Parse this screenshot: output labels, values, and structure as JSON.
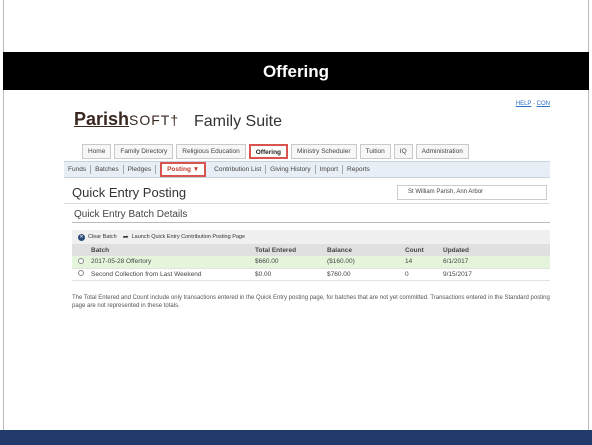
{
  "slide": {
    "title": "Offering",
    "accent_color": "#1f3a6b"
  },
  "app": {
    "top_links": [
      "HELP",
      "-",
      "CON"
    ],
    "logo_part1": "Parish",
    "logo_part2": "SOFT",
    "product_name": "Family Suite"
  },
  "main_nav": [
    {
      "label": "Home"
    },
    {
      "label": "Family Directory"
    },
    {
      "label": "Religious Education"
    },
    {
      "label": "Offering"
    },
    {
      "label": "Ministry Scheduler"
    },
    {
      "label": "Tuition"
    },
    {
      "label": "IQ"
    },
    {
      "label": "Administration"
    }
  ],
  "sub_nav": [
    {
      "label": "Funds"
    },
    {
      "label": "Batches"
    },
    {
      "label": "Pledges"
    },
    {
      "label": "Posting ▼"
    },
    {
      "label": "Contribution List"
    },
    {
      "label": "Giving History"
    },
    {
      "label": "Import"
    },
    {
      "label": "Reports"
    }
  ],
  "page": {
    "title": "Quick Entry Posting",
    "parish": "St William Parish, Ann Arbor",
    "section_title": "Quick Entry Batch Details",
    "toolbar": {
      "clear": "Clear Batch",
      "launch": "Launch Quick Entry Contribution Posting Page"
    },
    "table": {
      "headers": [
        "",
        "Batch",
        "Total Entered",
        "Balance",
        "Count",
        "Updated"
      ],
      "rows": [
        {
          "batch": "2017-05-28 Offertory",
          "total": "$660.00",
          "balance": "($160.00)",
          "count": "14",
          "updated": "6/1/2017"
        },
        {
          "batch": "Second Collection from Last Weekend",
          "total": "$0.00",
          "balance": "$760.00",
          "count": "0",
          "updated": "9/15/2017"
        }
      ]
    },
    "note": "The Total Entered and Count include only transactions entered in the Quick Entry posting page, for batches that are not yet committed. Transactions entered in the Standard posting page are not represented in these totals."
  }
}
